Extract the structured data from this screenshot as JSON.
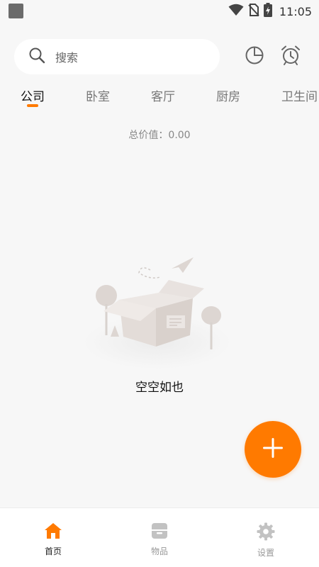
{
  "status_bar": {
    "time": "11:05"
  },
  "search": {
    "placeholder": "搜索"
  },
  "header_icons": [
    "pie-chart-icon",
    "alarm-clock-icon"
  ],
  "tabs": [
    {
      "label": "公司",
      "active": true
    },
    {
      "label": "卧室",
      "active": false
    },
    {
      "label": "客厅",
      "active": false
    },
    {
      "label": "厨房",
      "active": false
    },
    {
      "label": "卫生间",
      "active": false
    }
  ],
  "summary": {
    "total_value": "总价值：0.00"
  },
  "empty_state": {
    "text": "空空如也"
  },
  "fab": {
    "icon": "plus-icon"
  },
  "bottom_nav": [
    {
      "label": "首页",
      "icon": "home-icon",
      "active": true
    },
    {
      "label": "物品",
      "icon": "box-icon",
      "active": false
    },
    {
      "label": "设置",
      "icon": "gear-icon",
      "active": false
    }
  ],
  "colors": {
    "accent": "#ff7a00",
    "background": "#f7f7f7",
    "inactive": "#c2c2c2"
  }
}
